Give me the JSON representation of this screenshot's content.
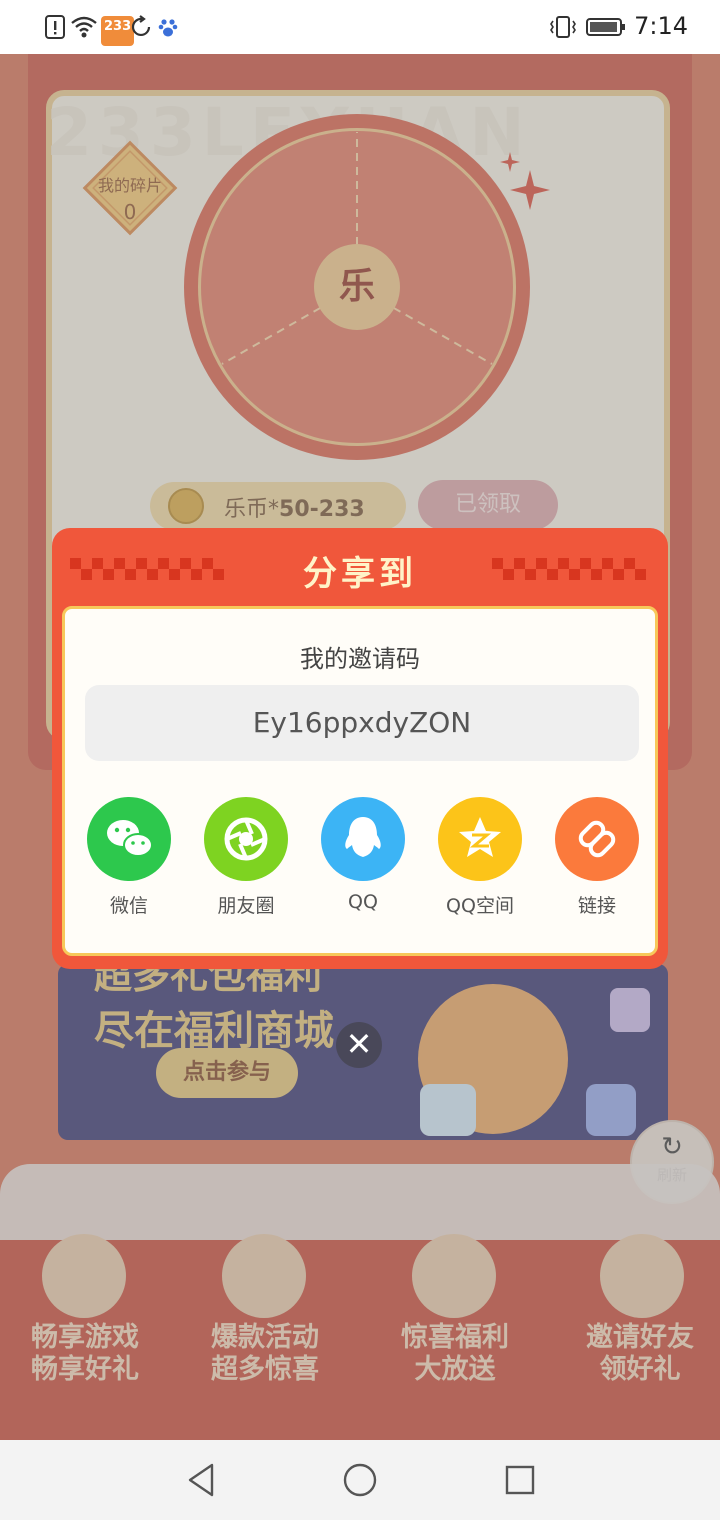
{
  "status_bar": {
    "time": "7:14",
    "badge": "233",
    "icons": [
      "alert-icon",
      "wifi-icon",
      "app-badge-icon",
      "sync-icon",
      "baidu-paw-icon",
      "vibrate-icon",
      "battery-icon"
    ]
  },
  "background": {
    "watermark": "233LEYUAN",
    "fragments_label": "我的碎片",
    "fragments_count": "0",
    "wheel_center": "乐",
    "reward_prefix": "乐币*",
    "reward_value": "50-233",
    "claimed_label": "已领取",
    "banner_line1": "超多礼包福利",
    "banner_line2": "尽在福利商城",
    "join_label": "点击参与",
    "refresh_label": "刷新",
    "features": [
      {
        "line1": "畅享游戏",
        "line2": "畅享好礼"
      },
      {
        "line1": "爆款活动",
        "line2": "超多惊喜"
      },
      {
        "line1": "惊喜福利",
        "line2": "大放送"
      },
      {
        "line1": "邀请好友",
        "line2": "领好礼"
      }
    ]
  },
  "share_dialog": {
    "title": "分享到",
    "invite_label": "我的邀请码",
    "invite_code": "Ey16ppxdyZON",
    "targets": [
      {
        "label": "微信",
        "icon": "wechat-icon",
        "color": "#2dc84d"
      },
      {
        "label": "朋友圈",
        "icon": "moments-icon",
        "color": "#7ed321"
      },
      {
        "label": "QQ",
        "icon": "qq-icon",
        "color": "#3cb4f5"
      },
      {
        "label": "QQ空间",
        "icon": "qzone-icon",
        "color": "#fcc419"
      },
      {
        "label": "链接",
        "icon": "link-icon",
        "color": "#fb7a3c"
      }
    ]
  },
  "colors": {
    "dialog_bg": "#f0573b",
    "dialog_title": "#fff3c8",
    "panel_bg": "#fffdf8"
  }
}
